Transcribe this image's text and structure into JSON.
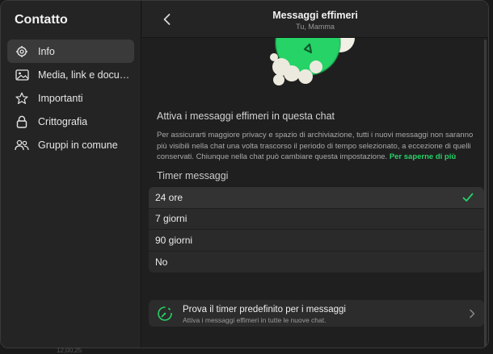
{
  "sidebar": {
    "title": "Contatto",
    "items": [
      {
        "label": "Info",
        "icon": "gear-icon",
        "active": true
      },
      {
        "label": "Media, link e documenti",
        "icon": "image-icon",
        "active": false
      },
      {
        "label": "Importanti",
        "icon": "star-icon",
        "active": false
      },
      {
        "label": "Crittografia",
        "icon": "lock-icon",
        "active": false
      },
      {
        "label": "Gruppi in comune",
        "icon": "people-icon",
        "active": false
      }
    ]
  },
  "header": {
    "title": "Messaggi effimeri",
    "subtitle": "Tu, Mamma"
  },
  "main": {
    "section_title": "Attiva i messaggi effimeri in questa chat",
    "description": "Per assicurarti maggiore privacy e spazio di archiviazione, tutti i nuovi messaggi non saranno più visibili nella chat una volta trascorso il periodo di tempo selezionato, a eccezione di quelli conservati. Chiunque nella chat può cambiare questa impostazione.",
    "learn_more": "Per saperne di più",
    "timer_title": "Timer messaggi",
    "options": [
      {
        "label": "24 ore",
        "selected": true
      },
      {
        "label": "7 giorni",
        "selected": false
      },
      {
        "label": "90 giorni",
        "selected": false
      },
      {
        "label": "No",
        "selected": false
      }
    ],
    "promo": {
      "title": "Prova il timer predefinito per i messaggi",
      "subtitle": "Attiva i messaggi effimeri in tutte le nuove chat."
    }
  },
  "background_text": "12,00,25",
  "colors": {
    "accent": "#25d366",
    "sidebar_bg": "#242424",
    "main_bg": "#1f1f1f",
    "row_bg": "#2a2a2a"
  }
}
